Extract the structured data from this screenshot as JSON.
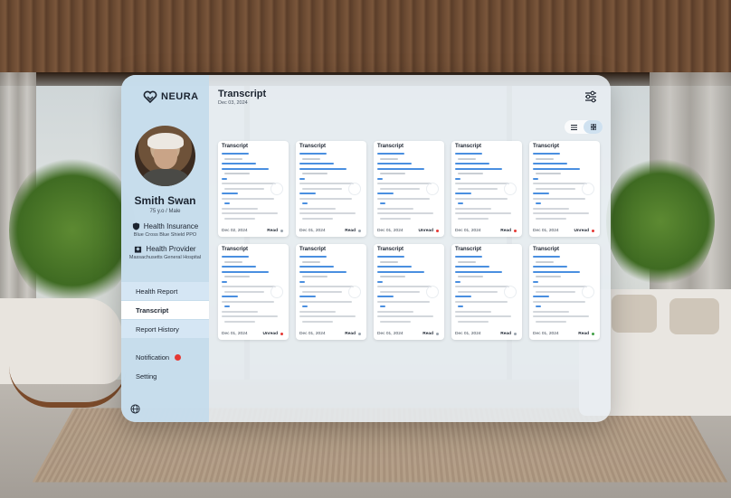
{
  "app": {
    "brand": "NEURA",
    "accent": "#4a8fe0"
  },
  "patient": {
    "name": "Smith Swan",
    "age_gender": "75 y.o / Male",
    "insurance_label": "Health Insurance",
    "insurance_value": "Blue Cross Blue Shield PPO",
    "provider_label": "Health Provider",
    "provider_value": "Massachusetts General Hospital"
  },
  "nav": {
    "items": [
      {
        "label": "Health Report"
      },
      {
        "label": "Transcript"
      },
      {
        "label": "Report History"
      }
    ],
    "notification_label": "Notification",
    "setting_label": "Setting"
  },
  "header": {
    "title": "Transcript",
    "date": "Dec 03, 2024"
  },
  "cards": [
    {
      "title": "Transcript",
      "date": "Dec 02, 2024",
      "status": "Read",
      "status_color": "#9aa3ad"
    },
    {
      "title": "Transcript",
      "date": "Dec 01, 2024",
      "status": "Read",
      "status_color": "#9aa3ad"
    },
    {
      "title": "Transcript",
      "date": "Dec 01, 2024",
      "status": "Unread",
      "status_color": "#e53935"
    },
    {
      "title": "Transcript",
      "date": "Dec 01, 2024",
      "status": "Read",
      "status_color": "#e53935"
    },
    {
      "title": "Transcript",
      "date": "Dec 01, 2024",
      "status": "Unread",
      "status_color": "#e53935"
    },
    {
      "title": "Transcript",
      "date": "Dec 01, 2024",
      "status": "Unread",
      "status_color": "#e53935"
    },
    {
      "title": "Transcript",
      "date": "Dec 01, 2024",
      "status": "Read",
      "status_color": "#9aa3ad"
    },
    {
      "title": "Transcript",
      "date": "Dec 01, 2024",
      "status": "Read",
      "status_color": "#9aa3ad"
    },
    {
      "title": "Transcript",
      "date": "Dec 01, 2024",
      "status": "Read",
      "status_color": "#9aa3ad"
    },
    {
      "title": "Transcript",
      "date": "Dec 01, 2024",
      "status": "Read",
      "status_color": "#43a047"
    }
  ],
  "icons": {
    "logo": "heart-logo-icon",
    "insurance": "shield-icon",
    "provider": "hospital-icon",
    "filter": "sliders-icon",
    "list_view": "list-icon",
    "grid_view": "grid-icon",
    "language": "globe-icon"
  }
}
